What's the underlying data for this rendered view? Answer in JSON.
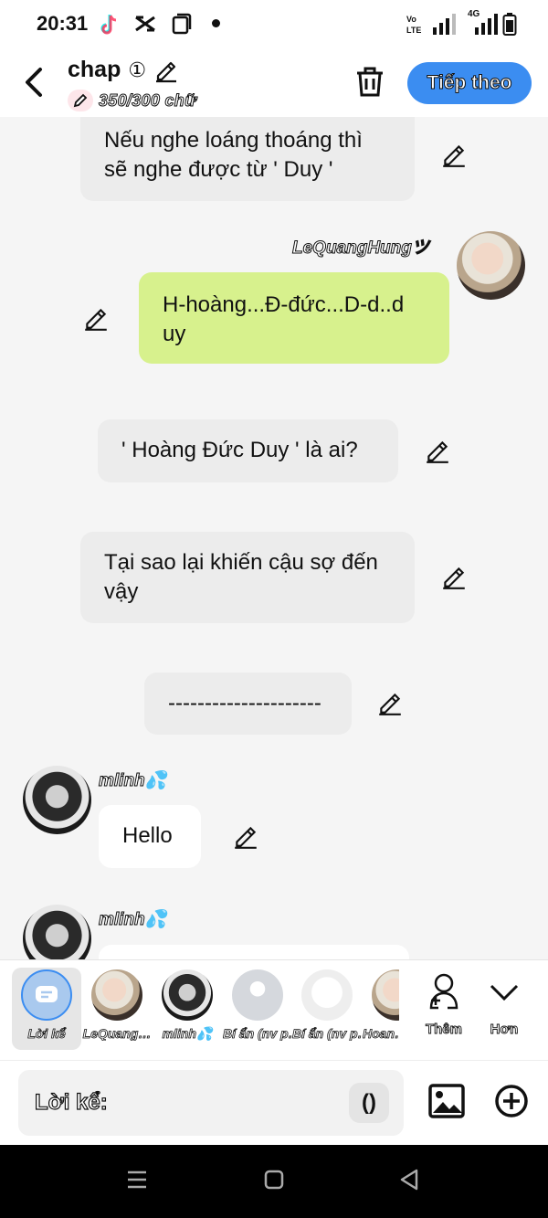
{
  "status_bar": {
    "time": "20:31",
    "network": "4G"
  },
  "header": {
    "title": "chap",
    "title_badge": "①",
    "char_count": "350/300 chữ",
    "next_label": "Tiếp theo"
  },
  "messages": [
    {
      "text": "Nếu nghe loáng thoáng thì sẽ nghe được từ ' Duy '"
    },
    {
      "sender": "LeQuangHungツ",
      "text": "H-hoàng...Đ-đức...D-d..d uy"
    },
    {
      "text": "' Hoàng Đức Duy ' là ai?"
    },
    {
      "text": "Tại sao lại khiến cậu sợ đến vậy"
    },
    {
      "text": "---------------------"
    },
    {
      "sender": "mlinh💦",
      "text": "Hello"
    },
    {
      "sender": "mlinh💦",
      "text": ""
    }
  ],
  "characters": [
    {
      "label": "Lời kể",
      "avatar": "narrator-icon"
    },
    {
      "label": "LeQuang…",
      "avatar": "light"
    },
    {
      "label": "mlinh💦",
      "avatar": "dark"
    },
    {
      "label": "Bí ẩn (nv p…",
      "avatar": "grey"
    },
    {
      "label": "Bí ẩn (nv p…",
      "avatar": "pink"
    },
    {
      "label": "Hoan…",
      "avatar": "partial"
    }
  ],
  "picker_actions": {
    "more_label": "Thêm",
    "expand_label": "Hơn"
  },
  "input": {
    "placeholder": "Lời kể:",
    "paren_label": "()"
  }
}
